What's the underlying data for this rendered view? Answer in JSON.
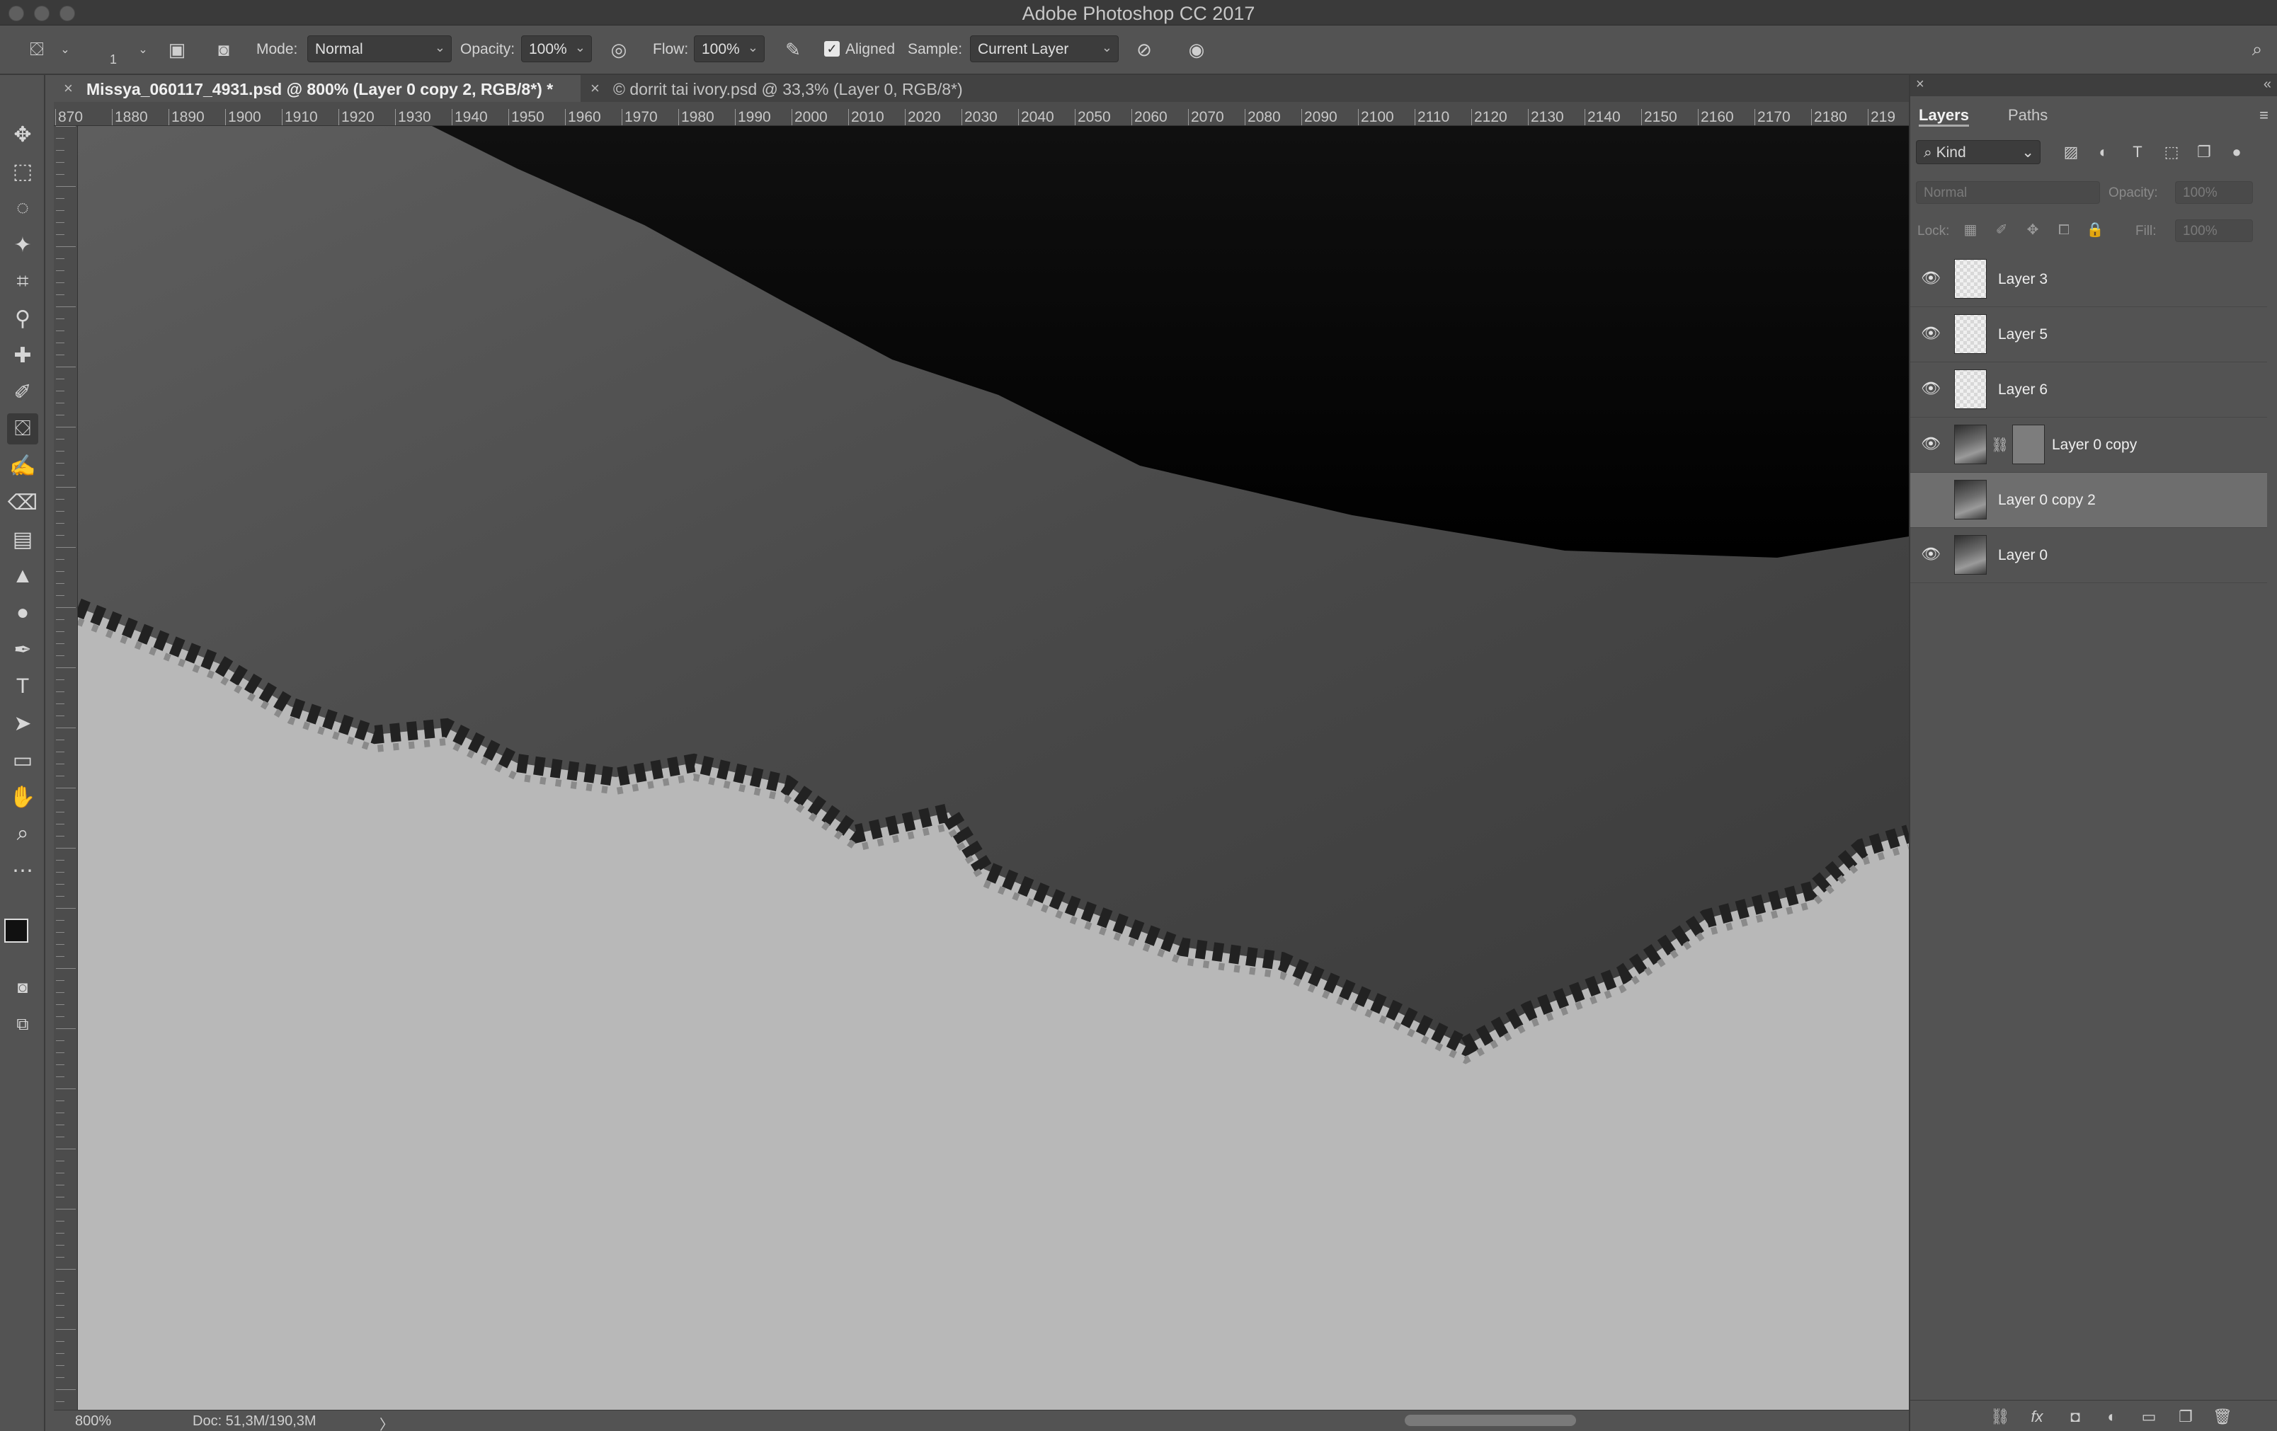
{
  "app": {
    "title": "Adobe Photoshop CC 2017"
  },
  "options": {
    "mode_label": "Mode:",
    "mode_value": "Normal",
    "opacity_label": "Opacity:",
    "opacity_value": "100%",
    "flow_label": "Flow:",
    "flow_value": "100%",
    "aligned_label": "Aligned",
    "aligned_checked": true,
    "sample_label": "Sample:",
    "sample_value": "Current Layer",
    "brush_size": "1"
  },
  "tabs": [
    {
      "title": "Missya_060117_4931.psd @ 800% (Layer 0 copy 2, RGB/8*) *",
      "active": true
    },
    {
      "title": "© dorrit tai ivory.psd @ 33,3% (Layer 0, RGB/8*)",
      "active": false
    }
  ],
  "ruler": {
    "h_ticks": [
      "870",
      "1880",
      "1890",
      "1900",
      "1910",
      "1920",
      "1930",
      "1940",
      "1950",
      "1960",
      "1970",
      "1980",
      "1990",
      "2000",
      "2010",
      "2020",
      "2030",
      "2040",
      "2050",
      "2060",
      "2070",
      "2080",
      "2090",
      "2100",
      "2110",
      "2120",
      "2130",
      "2140",
      "2150",
      "2160",
      "2170",
      "2180",
      "219"
    ]
  },
  "status": {
    "zoom": "800%",
    "doc": "Doc: 51,3M/190,3M",
    "arrow": "〉"
  },
  "panel": {
    "tabs": [
      "Layers",
      "Paths"
    ],
    "kind_label": "Kind",
    "blend_mode": "Normal",
    "opacity_label": "Opacity:",
    "opacity_value": "100%",
    "lock_label": "Lock:",
    "fill_label": "Fill:",
    "fill_value": "100%",
    "layers": [
      {
        "name": "Layer 3",
        "visible": true,
        "thumb": "transparent",
        "mask": false,
        "selected": false
      },
      {
        "name": "Layer 5",
        "visible": true,
        "thumb": "transparent",
        "mask": false,
        "selected": false
      },
      {
        "name": "Layer 6",
        "visible": true,
        "thumb": "transparent",
        "mask": false,
        "selected": false
      },
      {
        "name": "Layer 0 copy",
        "visible": true,
        "thumb": "photo",
        "mask": true,
        "selected": false
      },
      {
        "name": "Layer 0 copy 2",
        "visible": false,
        "thumb": "photo",
        "mask": false,
        "selected": true
      },
      {
        "name": "Layer 0",
        "visible": true,
        "thumb": "photo",
        "mask": false,
        "selected": false
      }
    ]
  },
  "icons": {
    "tools": [
      "move-icon",
      "marquee-icon",
      "lasso-icon",
      "magic-wand-icon",
      "crop-icon",
      "eyedropper-icon",
      "healing-brush-icon",
      "brush-icon",
      "clone-stamp-icon",
      "history-brush-icon",
      "eraser-icon",
      "gradient-icon",
      "blur-icon",
      "dodge-icon",
      "pen-icon",
      "type-icon",
      "path-select-icon",
      "rectangle-icon",
      "hand-icon",
      "zoom-icon",
      "more-icon"
    ]
  }
}
